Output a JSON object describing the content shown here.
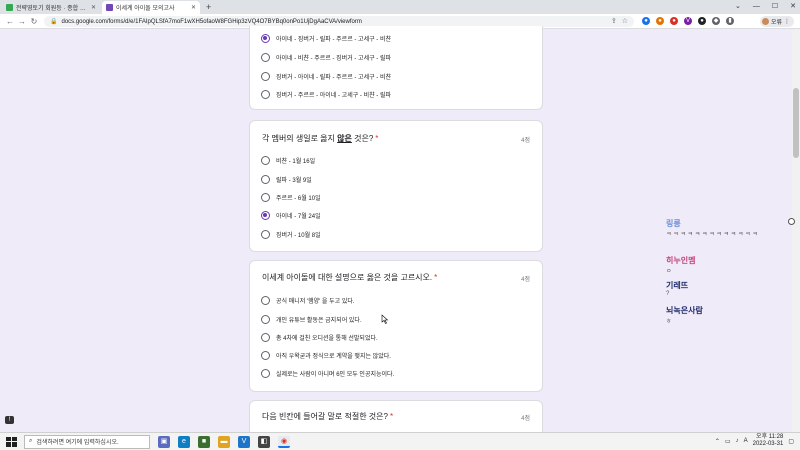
{
  "browser": {
    "tabs": [
      {
        "title": "전략영토기 회원등 · 종합 가서비스",
        "favicon_color": "#34a853"
      },
      {
        "title": "이세계 아이돌 모의고사",
        "favicon_color": "#7248b9"
      }
    ],
    "new_tab": "+",
    "url": "docs.google.com/forms/d/e/1FAIpQLSfA7moF1wXH5ofaoW8FGHip3zVQ4O7BYBq0onPo1UjDgAaCVA/viewform",
    "profile_label": "오류"
  },
  "form": {
    "q1_options": [
      {
        "label": "아이네 - 징버거 - 릴파 - 주르르 - 고세구 - 비챤",
        "selected": true
      },
      {
        "label": "아이네 - 비챤 - 주르르 - 징버거 - 고세구 - 릴파",
        "selected": false
      },
      {
        "label": "징버거 - 아이네 - 릴파 - 주르르 - 고세구 - 비챤",
        "selected": false
      },
      {
        "label": "징버거 - 주르르 - 아이네 - 고세구 - 비챤 - 릴파",
        "selected": false
      }
    ],
    "q2": {
      "title_pre": "각 멤버의 생일로 옳지 ",
      "title_emph": "않은",
      "title_post": " 것은?",
      "required": "*",
      "points": "4점",
      "options": [
        {
          "label": "비챤 - 1월 16일",
          "selected": false
        },
        {
          "label": "릴파 - 3월 9일",
          "selected": false
        },
        {
          "label": "주르르 - 6월 10일",
          "selected": false
        },
        {
          "label": "아이네 - 7월 24일",
          "selected": true
        },
        {
          "label": "징버거 - 10월 8일",
          "selected": false
        }
      ]
    },
    "q3": {
      "title": "이세계 아이돌에 대한 설명으로 옳은 것을 고르시오.",
      "required": "*",
      "points": "4점",
      "options": [
        {
          "label": "공식 매니저 '햄양' 을 두고 있다.",
          "selected": false
        },
        {
          "label": "개인 유튜브 활동은 금지되어 있다.",
          "selected": false
        },
        {
          "label": "총 4차에 걸친 오디션을 통해 선발되었다.",
          "selected": false
        },
        {
          "label": "아직 우왁굳과 정식으로 계약을 맺지는 않았다.",
          "selected": false
        },
        {
          "label": "실제로는 사람이 아니며 6인 모두 인공지능이다.",
          "selected": false
        }
      ]
    },
    "q4": {
      "title": "다음 빈칸에 들어갈 말로 적절한 것은?",
      "required": "*",
      "points": "4점"
    }
  },
  "overlay": {
    "items": [
      {
        "name": "링릉",
        "sub": "ㅋ ㅋ ㅋ ㅋ ㅋ ㅋ ㅋ ㅋ ㅋ ㅋ ㅋ ㅋ ㅋ",
        "color": "#6c8fd6"
      },
      {
        "name": "히누인멤",
        "sub": "ㅇ",
        "color": "#c2447a"
      },
      {
        "name": "기레뜨",
        "sub": "?",
        "color": "#1f2a6b"
      },
      {
        "name": "뇌녹은사람",
        "sub": "ㅎ",
        "color": "#1f2a6b"
      }
    ]
  },
  "taskbar": {
    "search_placeholder": "검색하려면 여기에 입력하십시오.",
    "time": "오후 11:28",
    "date": "2022-03-31",
    "tray_lang": "A",
    "feedback": "!"
  }
}
